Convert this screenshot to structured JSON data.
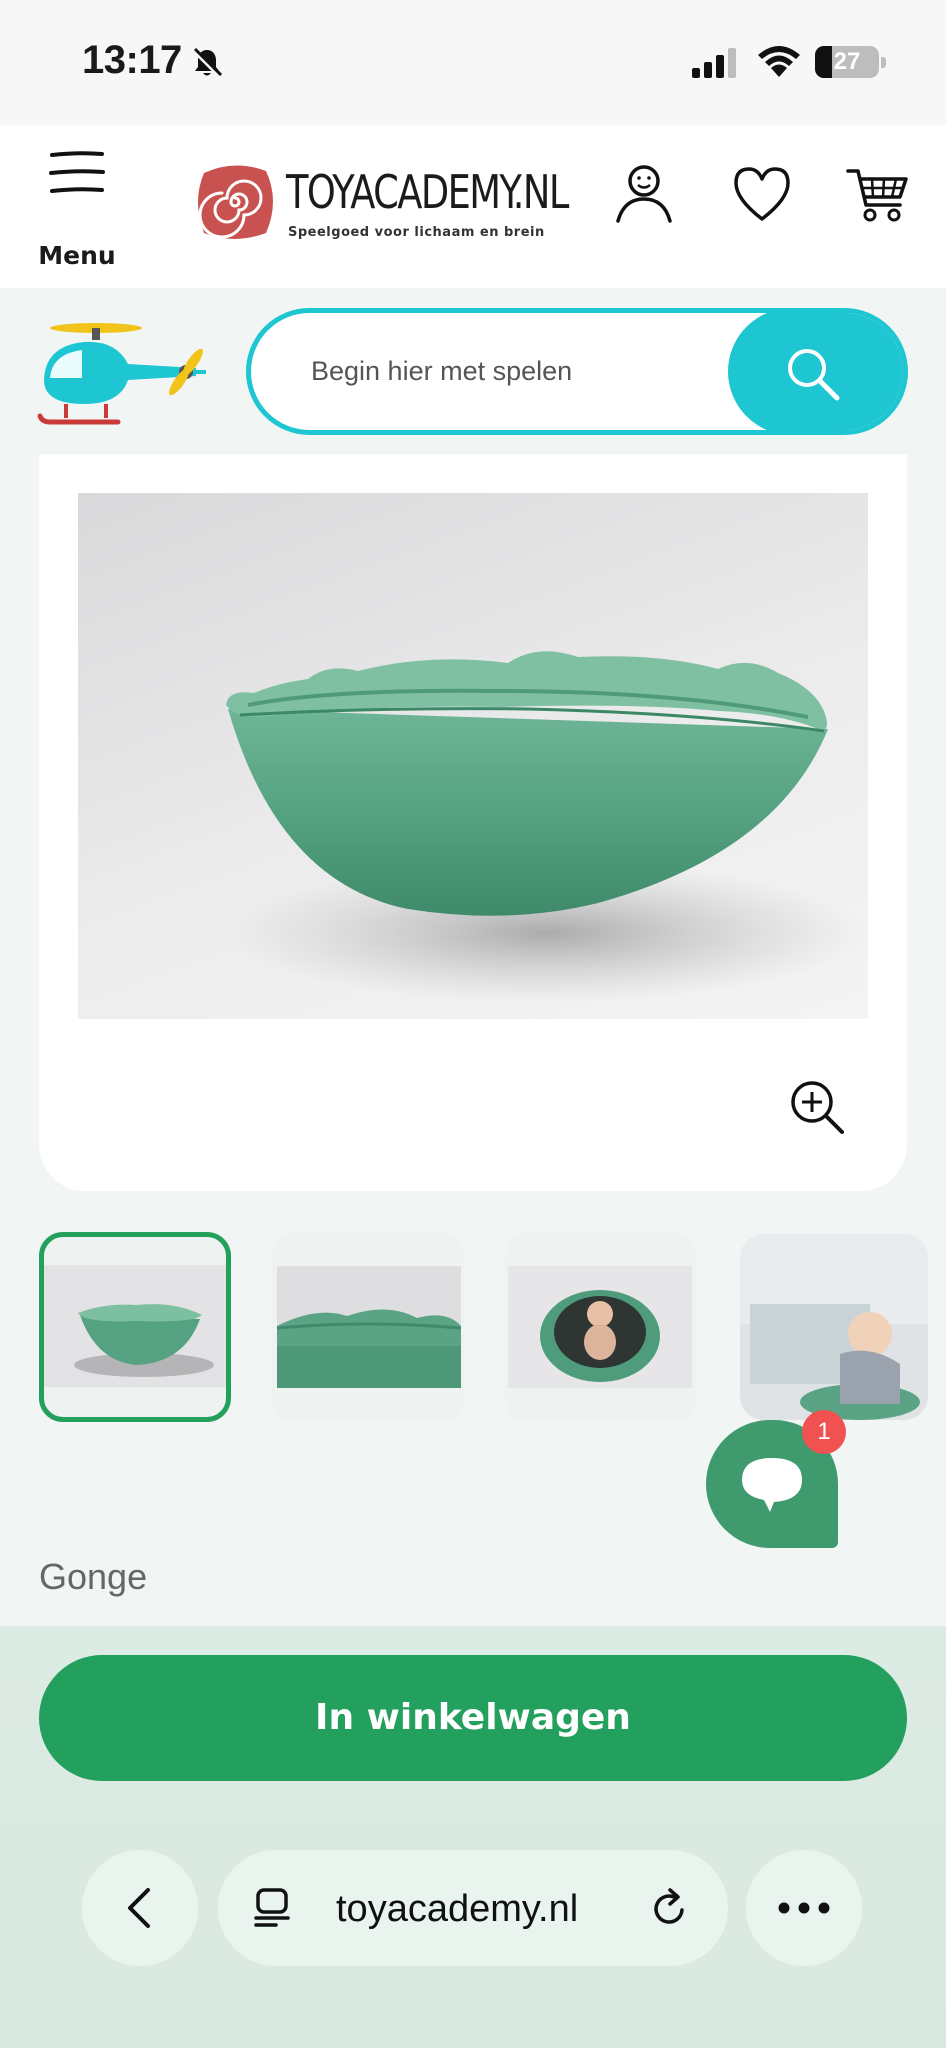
{
  "status_bar": {
    "time": "13:17",
    "battery": "27",
    "battery_level": 0.27
  },
  "header": {
    "menu_label": "Menu",
    "logo_name": "TOYACADEMY.NL",
    "logo_tagline": "Speelgoed voor lichaam en brein",
    "icons": [
      "hamburger-icon",
      "account-icon",
      "heart-icon",
      "cart-icon"
    ]
  },
  "search": {
    "placeholder": "Begin hier met spelen"
  },
  "product": {
    "brand": "Gonge",
    "thumbnail_count": 4,
    "active_thumbnail": 1
  },
  "chat": {
    "badge": "1"
  },
  "actions": {
    "add_to_cart": "In winkelwagen"
  },
  "browser": {
    "url": "toyacademy.nl"
  },
  "colors": {
    "accent_green": "#239f5e",
    "search_cyan": "#1ec6d2",
    "chat_green": "#3f9a6e",
    "badge_red": "#f05252",
    "logo_red": "#c8524f"
  }
}
